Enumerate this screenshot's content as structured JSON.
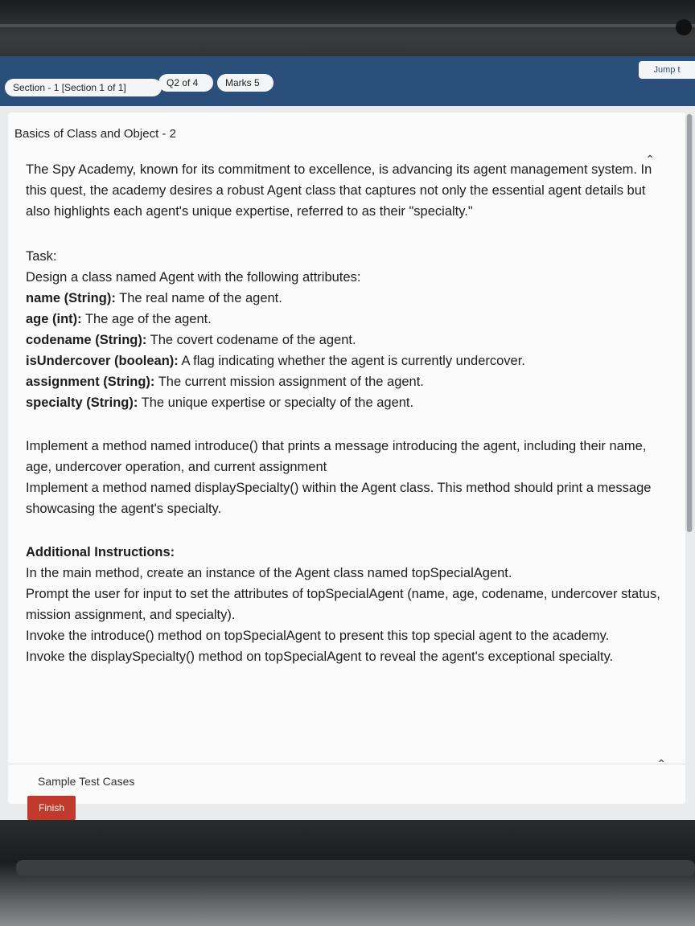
{
  "header": {
    "section_label": "Section - 1 [Section 1 of 1]",
    "question_label": "Q2 of 4",
    "marks_label": "Marks 5",
    "jump_label": "Jump t"
  },
  "question": {
    "title": "Basics of Class and Object - 2",
    "intro": "The Spy Academy, known for its commitment to excellence, is advancing its agent management system. In this quest, the academy desires a robust Agent class that captures not only the essential agent details but also highlights each agent's unique expertise, referred to as their \"specialty.\"",
    "task_heading": "Task:",
    "task_line": "Design a class named Agent with the following attributes:",
    "attributes": [
      {
        "name": "name (String):",
        "desc": " The real name of the agent."
      },
      {
        "name": "age (int):",
        "desc": " The age of the agent."
      },
      {
        "name": "codename (String):",
        "desc": " The covert codename of the agent."
      },
      {
        "name": "isUndercover (boolean):",
        "desc": " A flag indicating whether the agent is currently undercover."
      },
      {
        "name": "assignment (String):",
        "desc": " The current mission assignment of the agent."
      },
      {
        "name": "specialty (String):",
        "desc": " The unique expertise or specialty of the agent."
      }
    ],
    "implement_1": "Implement a method named introduce() that prints a message introducing the agent, including their name, age, undercover operation, and current assignment",
    "implement_2": "Implement a method named displaySpecialty() within the Agent class. This method should print a message showcasing the agent's specialty.",
    "additional_heading": "Additional Instructions:",
    "additional_1": "In the main method, create an instance of the Agent class named topSpecialAgent.",
    "additional_2": "Prompt the user for input to set the attributes of topSpecialAgent (name, age, codename, undercover status, mission assignment, and specialty).",
    "additional_3": "Invoke the introduce() method on topSpecialAgent to present this top special agent to the academy.",
    "additional_4": "Invoke the displaySpecialty() method on topSpecialAgent to reveal the agent's exceptional specialty."
  },
  "footer": {
    "sample_cases_label": "Sample Test Cases",
    "finish_label": "Finish"
  }
}
